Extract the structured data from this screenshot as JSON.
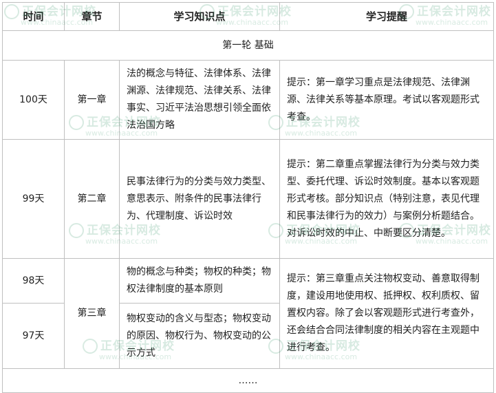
{
  "header": {
    "col_time": "时间",
    "col_chapter": "章节",
    "col_points": "学习知识点",
    "col_tips": "学习提醒"
  },
  "round_label": "第一轮 基础",
  "rows": [
    {
      "time": "100天",
      "chapter": "第一章",
      "points": "法的概念与特征、法律体系、法律渊源、法律规范、法律关系、法律事实、习近平法治思想引领全面依法治国方略",
      "tip": "提示：第一章学习重点是法律规范、法律渊源、法律关系等基本原理。考试以客观题形式考查。"
    },
    {
      "time": "99天",
      "chapter": "第二章",
      "points": "民事法律行为的分类与效力类型、意思表示、附条件的民事法律行为、代理制度、诉讼时效",
      "tip": "提示：第二章重点掌握法律行为分类与效力类型、委托代理、诉讼时效制度。基本以客观题形式考核。部分知识点（特别注意，表见代理和民事法律行为的效力）与案例分析题结合。对诉讼时效的中止、中断要区分清楚。"
    },
    {
      "time": "98天",
      "chapter": "第三章",
      "points": "物的概念与种类；物权的种类；物权法律制度的基本原则",
      "tip": "提示：第三章重点关注物权变动、善意取得制度，建设用地使用权、抵押权、权利质权、留置权内容。除了会以客观题形式进行考查外，还会结合合同法律制度的相关内容在主观题中进行考查。"
    },
    {
      "time": "97天",
      "points": "物权变动的含义与型态；物权变动的原因、物权行为、物权变动的公示方式"
    }
  ],
  "ellipsis": "……",
  "watermark": {
    "cn": "正保会计网校",
    "en": "www.chinaacc.com"
  }
}
